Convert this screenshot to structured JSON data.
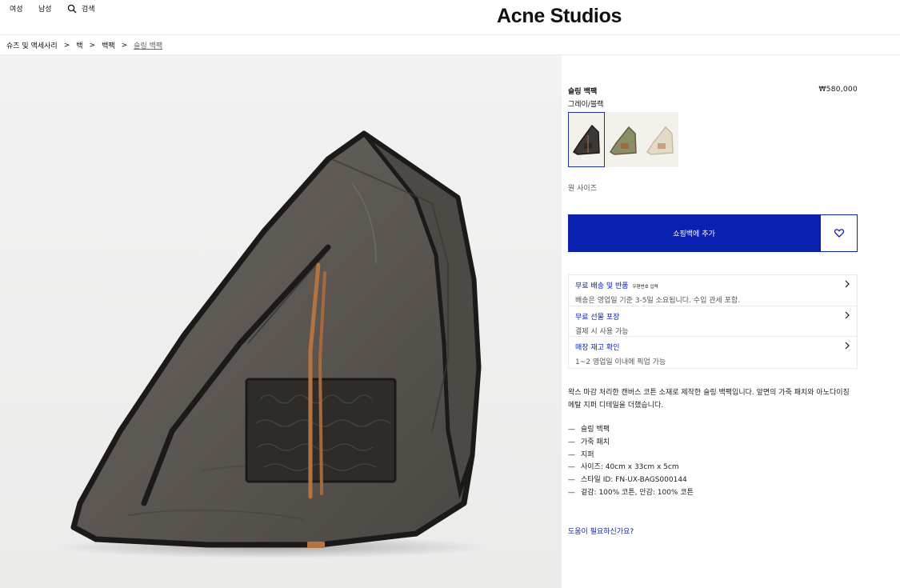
{
  "nav": {
    "women": "여성",
    "men": "남성",
    "search": "검색"
  },
  "logo": "Acne Studios",
  "breadcrumb": [
    "슈즈 및 액세사리",
    "백",
    "백팩",
    "슬링 백팩"
  ],
  "breadcrumb_separator": ">",
  "product": {
    "name": "슬링 백팩",
    "price": "₩580,000",
    "color": "그레이/블랙",
    "swatches": [
      {
        "color": "gray-black",
        "hex": "#3b3835",
        "selected": true
      },
      {
        "color": "green-brown",
        "hex": "#8a8f6a",
        "selected": false
      },
      {
        "color": "beige",
        "hex": "#d9cfbd",
        "selected": false
      }
    ],
    "size": "원 사이즈",
    "add_to_bag": "쇼핑백에 추가",
    "wishlist_icon": "heart-icon"
  },
  "accordion": [
    {
      "title": "무료 배송 및 반품",
      "tag": "우편번호 입력",
      "sub": "배송은 영업일 기준 3-5일 소요됩니다. 수입 관세 포함."
    },
    {
      "title": "무료 선물 포장",
      "tag": "",
      "sub": "결제 시 사용 가능"
    },
    {
      "title": "매장 재고 확인",
      "tag": "",
      "sub": "1~2 영업일 이내에 픽업 가능"
    }
  ],
  "description": "왁스 마감 처리한 캔버스 코튼 소재로 제작한 슬링 백팩입니다. 앞면의 가죽 패치와 아노다이징 메탈 지퍼 디테일을 더했습니다.",
  "feature_dash": "—",
  "features": [
    "슬링 백팩",
    "가죽 패치",
    "지퍼",
    "사이즈: 40cm x 33cm x 5cm",
    "스타일 ID: FN-UX-BAGS000144",
    "겉감: 100% 코튼, 안감: 100% 코튼"
  ],
  "help": "도움이 필요하신가요?",
  "colors": {
    "accent": "#0a21b0",
    "text": "#111111",
    "muted": "#555555",
    "border": "#eaeaea"
  }
}
